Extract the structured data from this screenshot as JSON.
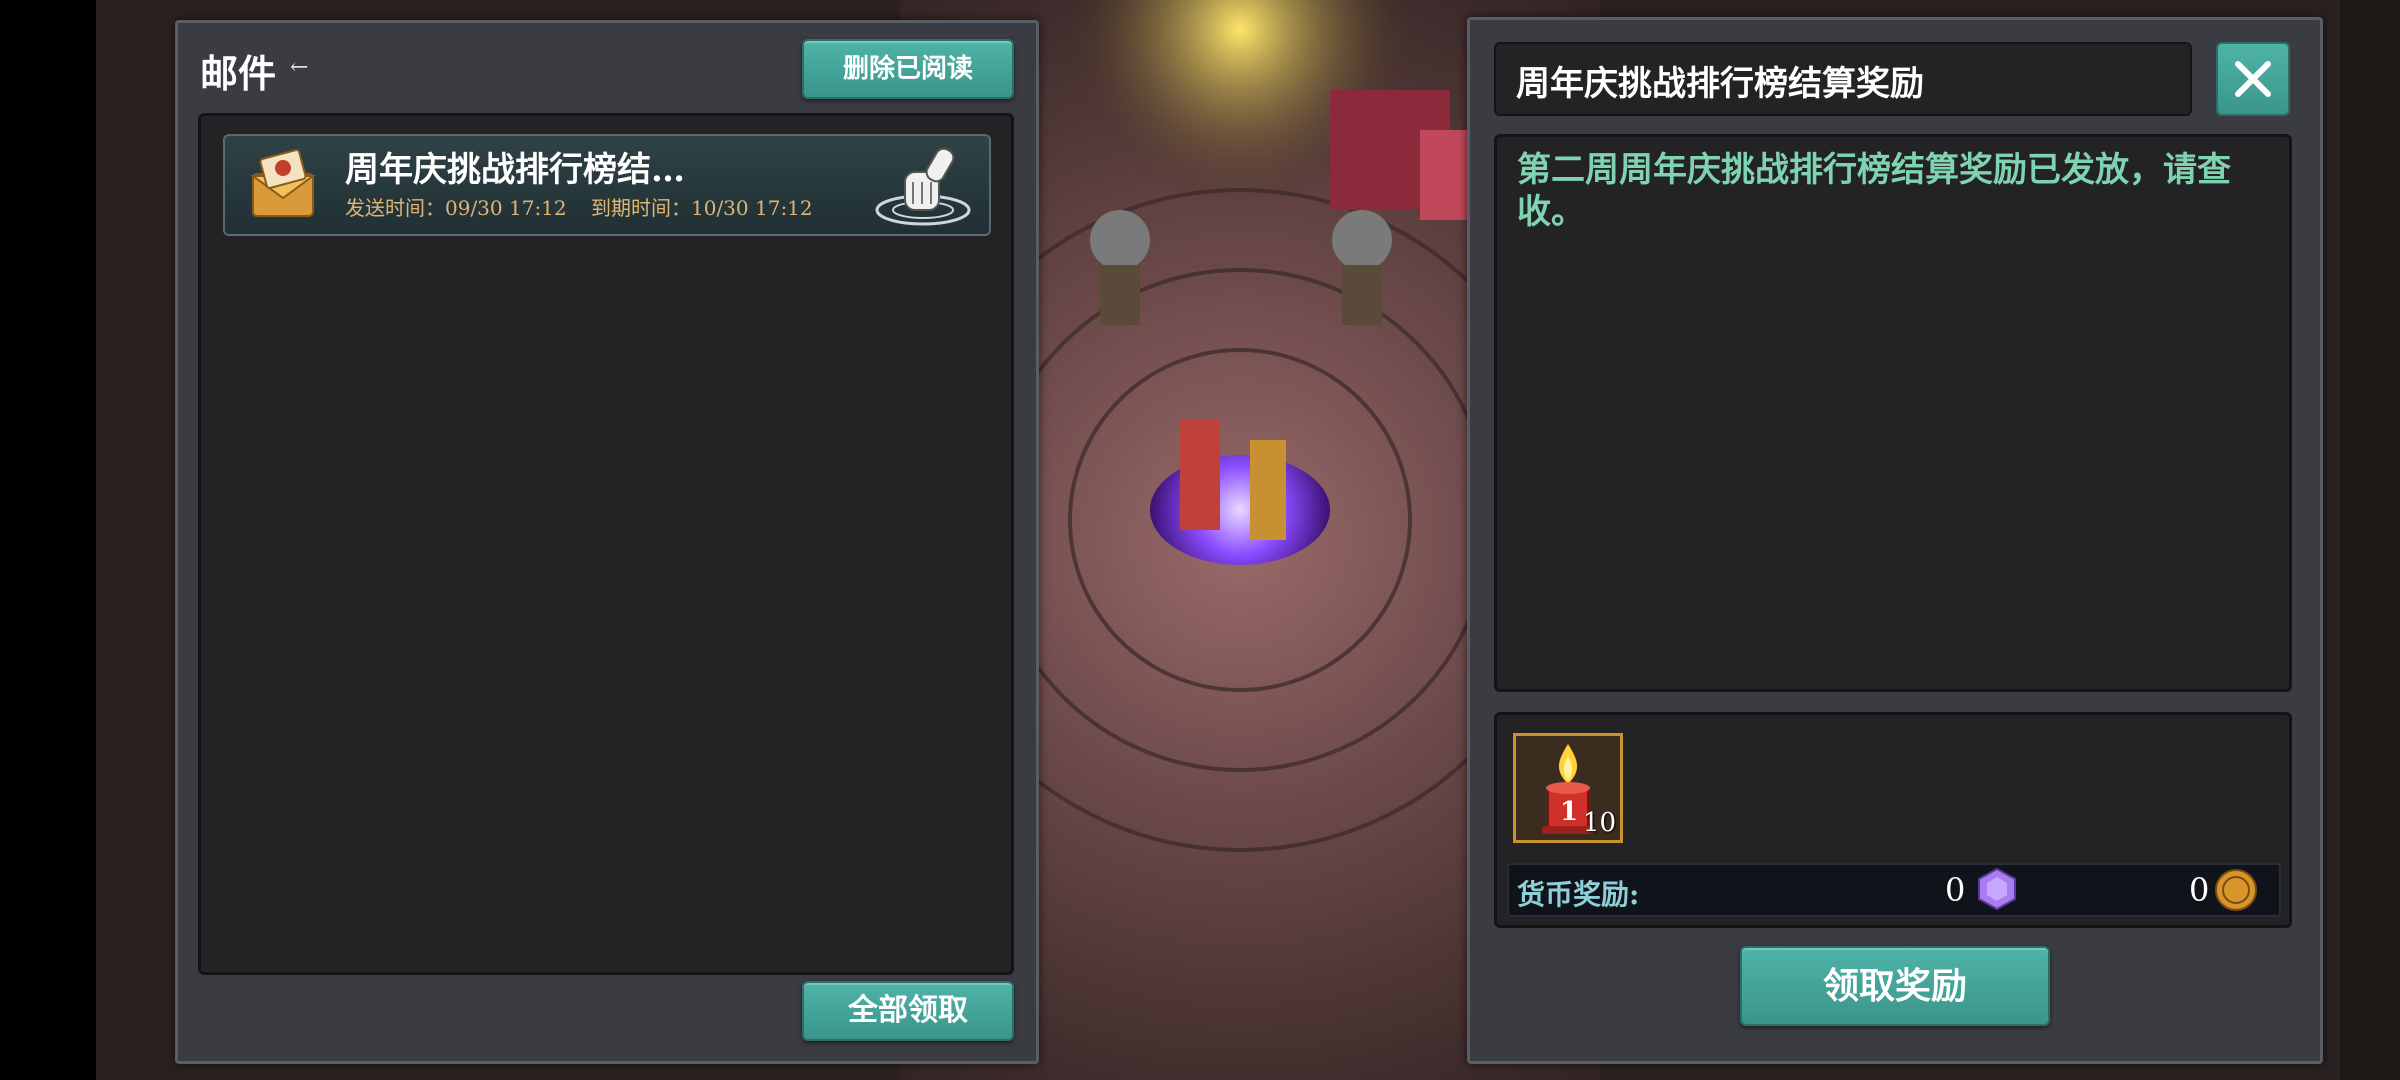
{
  "mail_panel": {
    "title": "邮件",
    "title_arrow": "←",
    "delete_read_label": "删除已阅读",
    "claim_all_label": "全部领取",
    "items": [
      {
        "subject": "周年庆挑战排行榜结…",
        "send_time": "发送时间：09/30 17:12",
        "expire_time": "到期时间：10/30 17:12",
        "icon": "envelope-icon",
        "action_icon": "hand-claim-icon"
      }
    ]
  },
  "detail_panel": {
    "title": "周年庆挑战排行榜结算奖励",
    "close_icon": "close-icon",
    "body": "第二周周年庆挑战排行榜结算奖励已发放，请查收。",
    "reward_item": {
      "icon": "candle-icon",
      "count": "10"
    },
    "currency_label": "货币奖励:",
    "gem_value": "0",
    "coin_value": "0",
    "claim_label": "领取奖励"
  },
  "colors": {
    "accent_teal": "#4fb3a8",
    "body_text": "#7fd3b0",
    "meta_text": "#e0b574"
  }
}
